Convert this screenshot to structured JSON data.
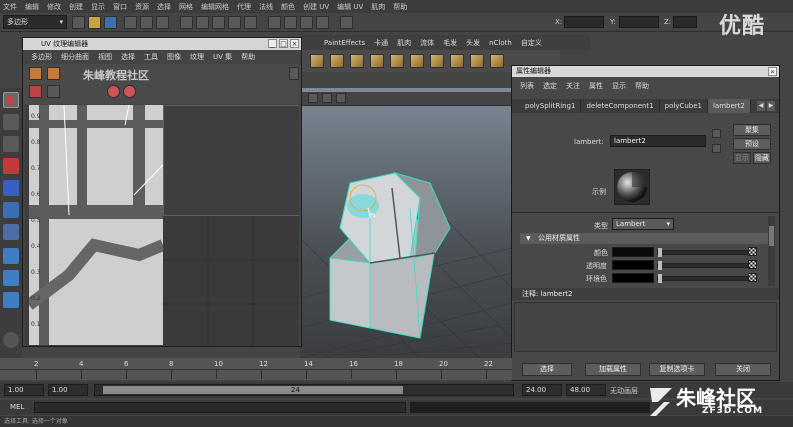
{
  "menubar": [
    "文件",
    "编辑",
    "修改",
    "创建",
    "显示",
    "窗口",
    "资源",
    "选择",
    "网格",
    "编辑网格",
    "代理",
    "法线",
    "颜色",
    "创建 UV",
    "编辑 UV",
    "肌肉",
    "帮助"
  ],
  "mode_menu": "多边形",
  "coords": {
    "x_label": "X:",
    "y_label": "Y:",
    "z_label": "Z:"
  },
  "watermark_top": "优酷",
  "shelf_tabs": [
    "PaintEffects",
    "卡通",
    "肌肉",
    "流体",
    "毛发",
    "头发",
    "nCloth",
    "自定义"
  ],
  "uv_editor": {
    "title": "UV 纹理编辑器",
    "menu": [
      "多边形",
      "细分曲面",
      "视图",
      "选择",
      "工具",
      "图像",
      "纹理",
      "UV 集",
      "帮助"
    ],
    "watermark": "朱峰教程社区",
    "axis_ticks": [
      "0.9",
      "0.8",
      "0.7",
      "0.6",
      "0.5",
      "0.4",
      "0.3",
      "0.2",
      "0.1"
    ]
  },
  "attr_editor": {
    "title": "属性编辑器",
    "menu": [
      "列表",
      "选定",
      "关注",
      "属性",
      "显示",
      "帮助"
    ],
    "tabs": [
      "polySplitRing1",
      "deleteComponent1",
      "polyCube1",
      "lambert2"
    ],
    "active_tab": "lambert2",
    "node_label": "lambert:",
    "node_value": "lambert2",
    "btn_focus": "聚集",
    "btn_preset": "预设",
    "btn_show": "显示",
    "btn_hide": "隐藏",
    "sample_label": "示例",
    "type_label": "类型",
    "type_value": "Lambert",
    "section_common": "公用材质属性",
    "color_label": "颜色",
    "transparency_label": "透明度",
    "ambient_label": "环境色",
    "notes": "注释: lambert2",
    "footer": [
      "选择",
      "加载属性",
      "复制选项卡",
      "关闭"
    ]
  },
  "timeline": {
    "ticks": [
      "2",
      "4",
      "6",
      "8",
      "10",
      "12",
      "14",
      "16",
      "18",
      "20",
      "22"
    ],
    "start": "1.00",
    "start2": "1.00",
    "current": "1",
    "range_end_marker": "24",
    "end": "24.00",
    "end2": "48.00",
    "anim_layer": "无动画层"
  },
  "cmdline_label": "MEL",
  "helpline": "选择工具: 选择一个对象",
  "watermark_bottom": {
    "cn": "朱峰社区",
    "en": "ZF3D.COM"
  },
  "colors": {
    "accent_blue": "#4a78b5",
    "selection_teal": "#35e0c8"
  }
}
